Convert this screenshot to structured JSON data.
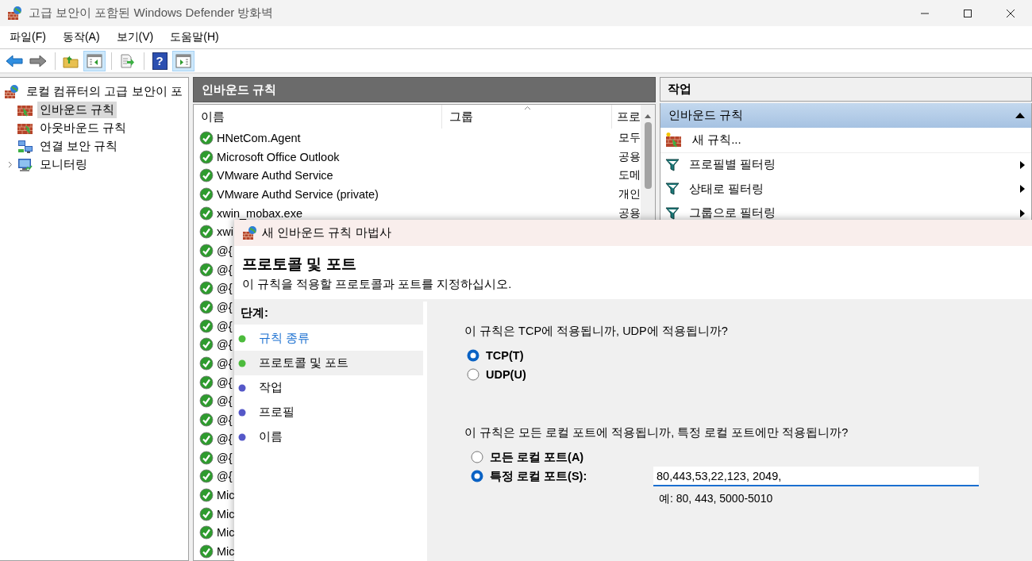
{
  "window": {
    "title": "고급 보안이 포함된 Windows Defender 방화벽"
  },
  "menu": [
    {
      "label": "파일(F)"
    },
    {
      "label": "동작(A)"
    },
    {
      "label": "보기(V)"
    },
    {
      "label": "도움말(H)"
    }
  ],
  "toolbar": [
    {
      "kind": "back",
      "pressed": false
    },
    {
      "kind": "forward",
      "pressed": false
    },
    {
      "kind": "separator"
    },
    {
      "kind": "up",
      "pressed": false
    },
    {
      "kind": "tree",
      "pressed": true
    },
    {
      "kind": "separator"
    },
    {
      "kind": "export",
      "pressed": false
    },
    {
      "kind": "separator"
    },
    {
      "kind": "help",
      "glyph": "?",
      "pressed": false
    },
    {
      "kind": "actions",
      "pressed": true
    }
  ],
  "tree": {
    "label": "로컬 컴퓨터의 고급 보안이 포",
    "children": [
      {
        "label": "인바운드 규칙",
        "kind": "inbound",
        "selected": true
      },
      {
        "label": "아웃바운드 규칙",
        "kind": "outbound",
        "selected": false
      },
      {
        "label": "연결 보안 규칙",
        "kind": "connection",
        "selected": false
      },
      {
        "label": "모니터링",
        "kind": "monitor",
        "selected": false,
        "expanded": false
      }
    ]
  },
  "rules_pane": {
    "title": "인바운드 규칙",
    "columns": [
      {
        "label": "이름",
        "sorted": false
      },
      {
        "label": "그룹",
        "sorted": true
      },
      {
        "label": "프로",
        "sorted": false
      }
    ],
    "rows": [
      {
        "name": "HNetCom.Agent",
        "profile": "모두",
        "enabled": true
      },
      {
        "name": "Microsoft Office Outlook",
        "profile": "공용",
        "enabled": true
      },
      {
        "name": "VMware Authd Service",
        "profile": "도메",
        "enabled": true
      },
      {
        "name": "VMware Authd Service (private)",
        "profile": "개인",
        "enabled": true
      },
      {
        "name": "xwin_mobax.exe",
        "profile": "공용",
        "enabled": true
      },
      {
        "name": "xwi",
        "enabled": true
      },
      {
        "name": "@{",
        "enabled": true
      },
      {
        "name": "@{",
        "enabled": true
      },
      {
        "name": "@{",
        "enabled": true
      },
      {
        "name": "@{",
        "enabled": true
      },
      {
        "name": "@{",
        "enabled": true
      },
      {
        "name": "@{",
        "enabled": true
      },
      {
        "name": "@{",
        "enabled": true
      },
      {
        "name": "@{",
        "enabled": true
      },
      {
        "name": "@{",
        "enabled": true
      },
      {
        "name": "@{",
        "enabled": true
      },
      {
        "name": "@{",
        "enabled": true
      },
      {
        "name": "@{",
        "enabled": true
      },
      {
        "name": "@{",
        "enabled": true
      },
      {
        "name": "Mic",
        "enabled": true
      },
      {
        "name": "Mic",
        "enabled": true
      },
      {
        "name": "Mic",
        "enabled": true
      },
      {
        "name": "Mic",
        "enabled": true
      }
    ]
  },
  "actions_pane": {
    "title": "작업",
    "section": {
      "label": "인바운드 규칙",
      "expanded": true
    },
    "items": [
      {
        "label": "새 규칙...",
        "kind": "new-rule",
        "submenu": false
      },
      {
        "label": "프로필별 필터링",
        "kind": "filter",
        "submenu": true
      },
      {
        "label": "상태로 필터링",
        "kind": "filter",
        "submenu": true
      },
      {
        "label": "그룹으로 필터링",
        "kind": "filter",
        "submenu": true
      }
    ]
  },
  "wizard": {
    "title": "새 인바운드 규칙 마법사",
    "heading": "프로토콜 및 포트",
    "description": "이 규칙을 적용할 프로토콜과 포트를 지정하십시오.",
    "steps_title": "단계:",
    "steps": [
      {
        "label": "규칙 종류",
        "done": true,
        "selected": false
      },
      {
        "label": "프로토콜 및 포트",
        "done": true,
        "selected": true
      },
      {
        "label": "작업",
        "done": false,
        "selected": false
      },
      {
        "label": "프로필",
        "done": false,
        "selected": false
      },
      {
        "label": "이름",
        "done": false,
        "selected": false
      }
    ],
    "protocol": {
      "question": "이 규칙은 TCP에 적용됩니까, UDP에 적용됩니까?",
      "options": [
        {
          "label": "TCP(T)",
          "selected": true
        },
        {
          "label": "UDP(U)",
          "selected": false
        }
      ]
    },
    "ports": {
      "question": "이 규칙은 모든 로컬 포트에 적용됩니까, 특정 로컬 포트에만 적용됩니까?",
      "options": [
        {
          "label": "모든 로컬 포트(A)",
          "selected": false
        },
        {
          "label": "특정 로컬 포트(S):",
          "selected": true
        }
      ],
      "value": "80,443,53,22,123, 2049,",
      "hint": "예: 80, 443, 5000-5010"
    }
  }
}
